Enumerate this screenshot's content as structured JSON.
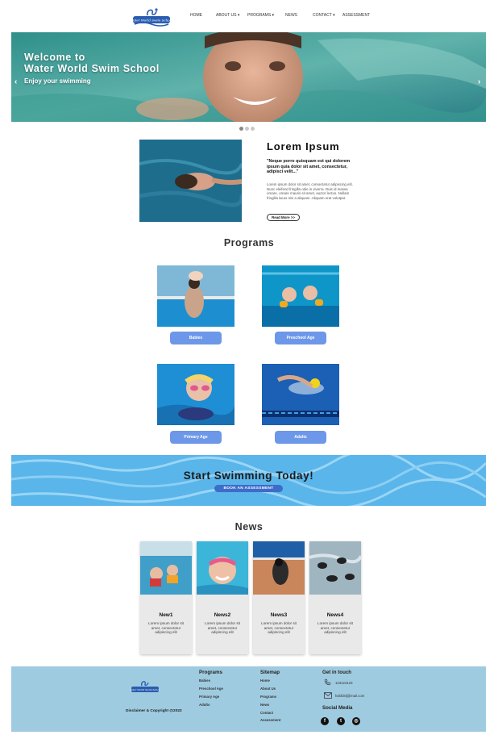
{
  "nav": {
    "logo_text": "Water World Swim School",
    "links": [
      "HOME",
      "ABOUT US ▾",
      "PROGRAMS ▾",
      "NEWS",
      "CONTACT ▾",
      "ASSESSMENT"
    ]
  },
  "hero": {
    "title_line1": "Welcome to",
    "title_line2": "Water World Swim School",
    "subtitle": "Enjoy your swimming",
    "prev": "‹",
    "next": "›",
    "slides": 3,
    "active_slide": 1
  },
  "intro": {
    "title": "Lorem Ipsum",
    "quote": "\"Neque porro quisquam est qui dolorem ipsum quia dolor sit amet, consectetur, adipisci velit...\"",
    "body": "Lorem ipsum dolor sit amet, consectetur adipiscing elit. Nunc eleifend fringilla odio in viverra. Duis id massa ornare, ornare mauris sit amet, auctor lectus. Nullam fringilla lacus nisi a aliquam. Aliquam erat volutpat.",
    "button": "Read More >>"
  },
  "programs": {
    "title": "Programs",
    "items": [
      {
        "label": "Babies"
      },
      {
        "label": "Preschool Age"
      },
      {
        "label": "Primary Age"
      },
      {
        "label": "Adults"
      }
    ]
  },
  "cta": {
    "title": "Start Swimming Today!",
    "button": "BOOK AN ASSESSMENT"
  },
  "news": {
    "title": "News",
    "items": [
      {
        "title": "New1",
        "body": "Lorem ipsum dolor sit amet, consectetur adipiscing elit"
      },
      {
        "title": "News2",
        "body": "Lorem ipsum dolor sit amet, consectetur adipiscing elit"
      },
      {
        "title": "News3",
        "body": "Lorem ipsum dolor sit amet, consectetur adipiscing elit"
      },
      {
        "title": "News4",
        "body": "Lorem ipsum dolor sit amet, consectetur adipiscing elit"
      }
    ]
  },
  "footer": {
    "copyright": "Disclaimer & Copyright @2022",
    "programs_title": "Programs",
    "programs_links": [
      "Babies",
      "Preschool Age",
      "Primary Age",
      "Adults"
    ],
    "sitemap_title": "Sitemap",
    "sitemap_links": [
      "Home",
      "About Us",
      "Programs",
      "News",
      "Contact",
      "Assessment"
    ],
    "contact_title": "Get in touch",
    "phone": "123123123",
    "email": "hdsfdsfj@mail.com",
    "social_title": "Social Media",
    "social_icons": [
      "facebook-icon",
      "twitter-icon",
      "instagram-icon"
    ]
  },
  "colors": {
    "accent": "#6d97e8",
    "cta_button": "#3d6cc9",
    "footer_bg": "#9fcbe0"
  }
}
